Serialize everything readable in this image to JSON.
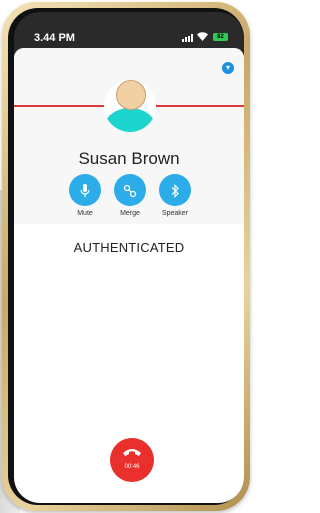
{
  "status_bar": {
    "time": "3.44 PM",
    "wifi_icon": "wifi-icon",
    "battery_label": "82"
  },
  "contact": {
    "name": "Susan Brown"
  },
  "actions": [
    {
      "label": "Mute",
      "icon": "microphone-icon"
    },
    {
      "label": "Merge",
      "icon": "merge-icon"
    },
    {
      "label": "Speaker",
      "icon": "bluetooth-speaker-icon"
    }
  ],
  "call": {
    "status": "AUTHENTICATED",
    "timer": "00:46"
  },
  "colors": {
    "accent": "#2cace8",
    "hangup": "#e9302c",
    "divider": "#d83a3a",
    "avatar_body": "#1ed4cf"
  }
}
